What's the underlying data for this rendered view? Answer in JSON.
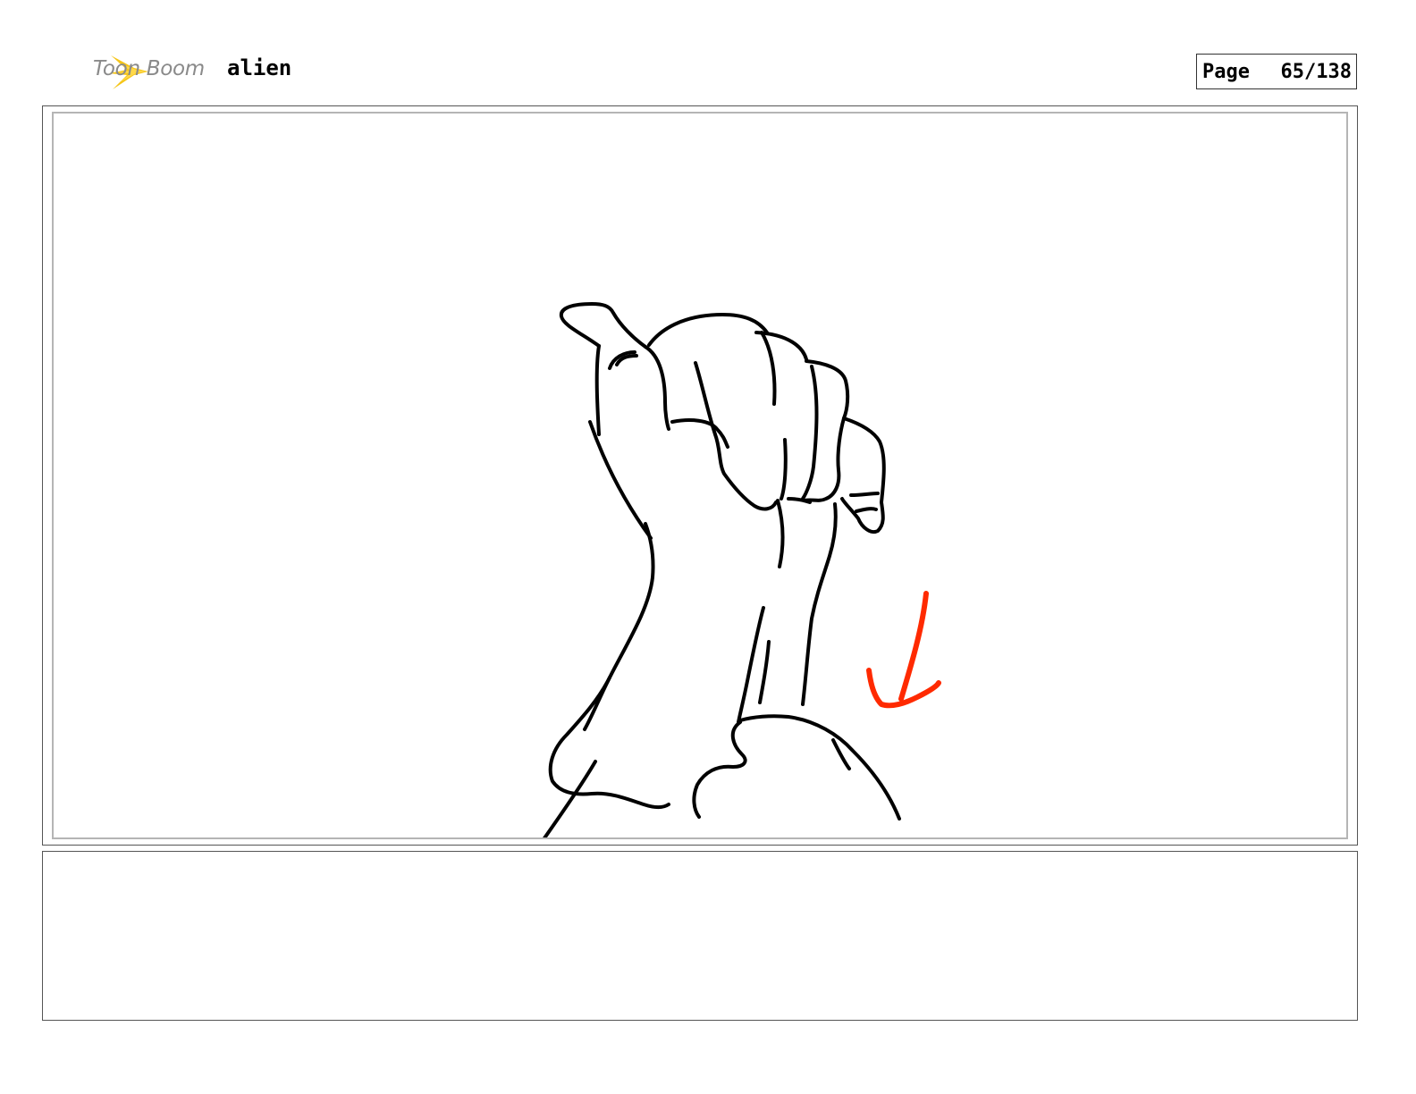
{
  "header": {
    "brand_name": "Toon Boom",
    "project_title": "alien",
    "page_label": "Page",
    "page_number": "65/138"
  },
  "colors": {
    "logo_star": "#f5c518",
    "logo_text": "#8a8a8a",
    "sketch_line": "#000000",
    "arrow": "#ff2a00",
    "panel_border": "#b5b5b5"
  },
  "panel": {
    "icon": "hand-thumb-sketch",
    "annotation_icon": "red-down-arrow-icon"
  },
  "notes": {
    "text": ""
  }
}
